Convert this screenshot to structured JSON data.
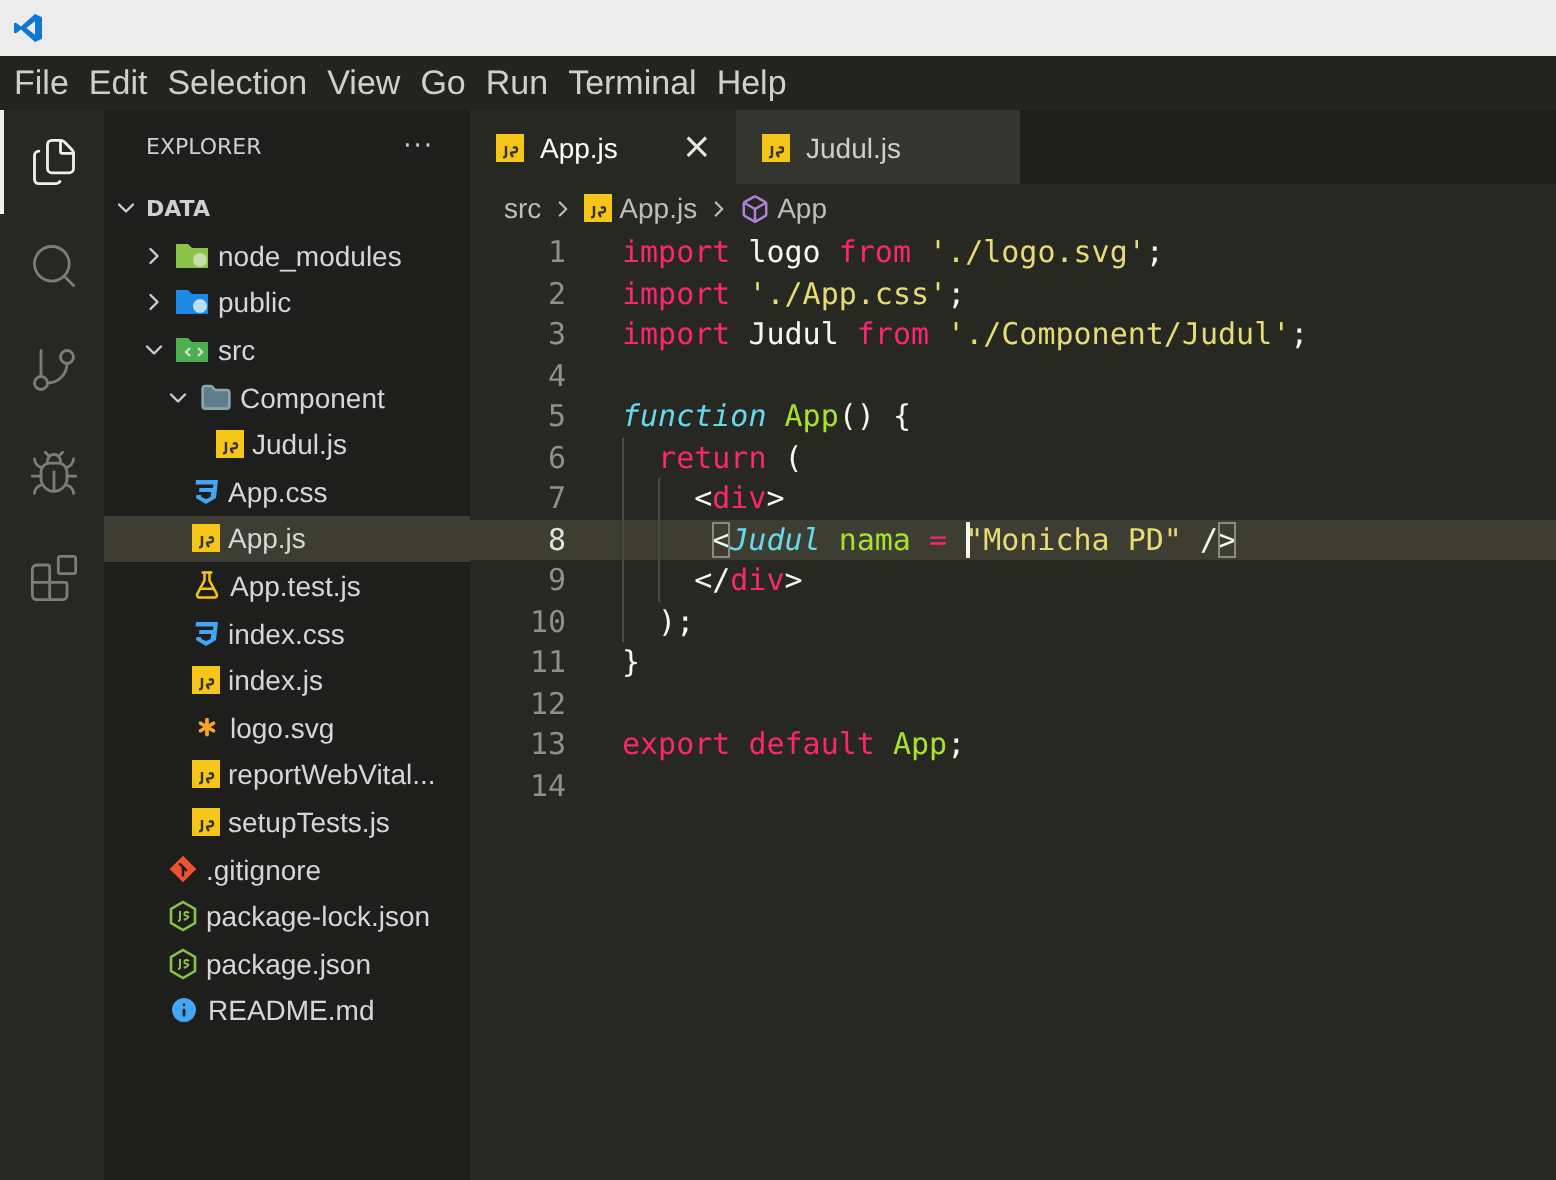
{
  "menu": [
    "File",
    "Edit",
    "Selection",
    "View",
    "Go",
    "Run",
    "Terminal",
    "Help"
  ],
  "activity_bar": [
    {
      "kind": "files",
      "selected": true
    },
    {
      "kind": "search",
      "selected": false
    },
    {
      "kind": "source-control",
      "selected": false
    },
    {
      "kind": "debug",
      "selected": false
    },
    {
      "kind": "extensions",
      "selected": false
    }
  ],
  "sidebar": {
    "title": "EXPLORER",
    "more": "···",
    "section": {
      "label": "DATA",
      "expanded": true
    },
    "items": [
      {
        "label": "node_modules",
        "kind": "folder-node",
        "expanded": false,
        "selected": false
      },
      {
        "label": "public",
        "kind": "folder-public",
        "expanded": false,
        "selected": false
      },
      {
        "label": "src",
        "kind": "folder-src",
        "expanded": true,
        "selected": false,
        "children": [
          {
            "label": "Component",
            "kind": "folder",
            "expanded": true,
            "selected": false,
            "children": [
              {
                "label": "Judul.js",
                "kind": "js",
                "selected": false
              }
            ]
          },
          {
            "label": "App.css",
            "kind": "css",
            "selected": false
          },
          {
            "label": "App.js",
            "kind": "js",
            "selected": true
          },
          {
            "label": "App.test.js",
            "kind": "test",
            "selected": false
          },
          {
            "label": "index.css",
            "kind": "css",
            "selected": false
          },
          {
            "label": "index.js",
            "kind": "js",
            "selected": false
          },
          {
            "label": "logo.svg",
            "kind": "svg",
            "selected": false
          },
          {
            "label": "reportWebVital...",
            "kind": "js",
            "selected": false
          },
          {
            "label": "setupTests.js",
            "kind": "js",
            "selected": false
          }
        ]
      },
      {
        "label": ".gitignore",
        "kind": "git",
        "selected": false
      },
      {
        "label": "package-lock.json",
        "kind": "node",
        "selected": false
      },
      {
        "label": "package.json",
        "kind": "node",
        "selected": false
      },
      {
        "label": "README.md",
        "kind": "info",
        "selected": false
      }
    ]
  },
  "tabs": [
    {
      "label": "App.js",
      "selected": true,
      "close": "×"
    },
    {
      "label": "Judul.js",
      "selected": false
    }
  ],
  "breadcrumb": [
    {
      "label": "src",
      "kind": "folder"
    },
    {
      "label": "App.js",
      "kind": "js"
    },
    {
      "label": "App",
      "kind": "component"
    }
  ],
  "code": [
    {
      "number": "1",
      "current": false,
      "tokens": [
        {
          "text": "import",
          "kind": "keyword"
        },
        {
          "text": " logo ",
          "kind": "plain"
        },
        {
          "text": "from",
          "kind": "keyword"
        },
        {
          "text": " './logo.svg'",
          "kind": "string"
        },
        {
          "text": ";",
          "kind": "plain"
        }
      ]
    },
    {
      "number": "2",
      "current": false,
      "tokens": [
        {
          "text": "import",
          "kind": "keyword"
        },
        {
          "text": " './App.css'",
          "kind": "string"
        },
        {
          "text": ";",
          "kind": "plain"
        }
      ]
    },
    {
      "number": "3",
      "current": false,
      "tokens": [
        {
          "text": "import",
          "kind": "keyword"
        },
        {
          "text": " Judul ",
          "kind": "plain"
        },
        {
          "text": "from",
          "kind": "keyword"
        },
        {
          "text": " './Component/Judul'",
          "kind": "string"
        },
        {
          "text": ";",
          "kind": "plain"
        }
      ]
    },
    {
      "number": "4",
      "current": false
    },
    {
      "number": "5",
      "current": false,
      "tokens": [
        {
          "text": "function",
          "kind": "storage"
        },
        {
          "text": " App",
          "kind": "func"
        },
        {
          "text": "() {",
          "kind": "plain"
        }
      ]
    },
    {
      "number": "6",
      "current": false,
      "tokens": [
        {
          "text": "  return",
          "kind": "keyword"
        },
        {
          "text": " (",
          "kind": "plain"
        }
      ]
    },
    {
      "number": "7",
      "current": false,
      "tokens": [
        {
          "text": "    <",
          "kind": "plain"
        },
        {
          "text": "div",
          "kind": "keyword"
        },
        {
          "text": ">",
          "kind": "plain"
        }
      ]
    },
    {
      "number": "8",
      "current": true,
      "tokens": [
        {
          "text": "     <",
          "kind": "bracket"
        },
        {
          "text": "Judul",
          "kind": "storage"
        },
        {
          "text": " nama ",
          "kind": "func"
        },
        {
          "text": "= ",
          "kind": "keyword"
        },
        {
          "text": "\"Monicha PD\"",
          "kind": "string",
          "cursor_before": true
        },
        {
          "text": " /",
          "kind": "plain"
        },
        {
          "text": ">",
          "kind": "bracket"
        }
      ]
    },
    {
      "number": "9",
      "current": false,
      "tokens": [
        {
          "text": "    </",
          "kind": "plain"
        },
        {
          "text": "div",
          "kind": "keyword"
        },
        {
          "text": ">",
          "kind": "plain"
        }
      ]
    },
    {
      "number": "10",
      "current": false,
      "tokens": [
        {
          "text": "  );",
          "kind": "plain"
        }
      ]
    },
    {
      "number": "11",
      "current": false,
      "tokens": [
        {
          "text": "}",
          "kind": "plain"
        }
      ]
    },
    {
      "number": "12",
      "current": false
    },
    {
      "number": "13",
      "current": false,
      "tokens": [
        {
          "text": "export ",
          "kind": "keyword"
        },
        {
          "text": "default",
          "kind": "keyword"
        },
        {
          "text": " App",
          "kind": "func"
        },
        {
          "text": ";",
          "kind": "plain"
        }
      ]
    },
    {
      "number": "14",
      "current": false
    }
  ]
}
